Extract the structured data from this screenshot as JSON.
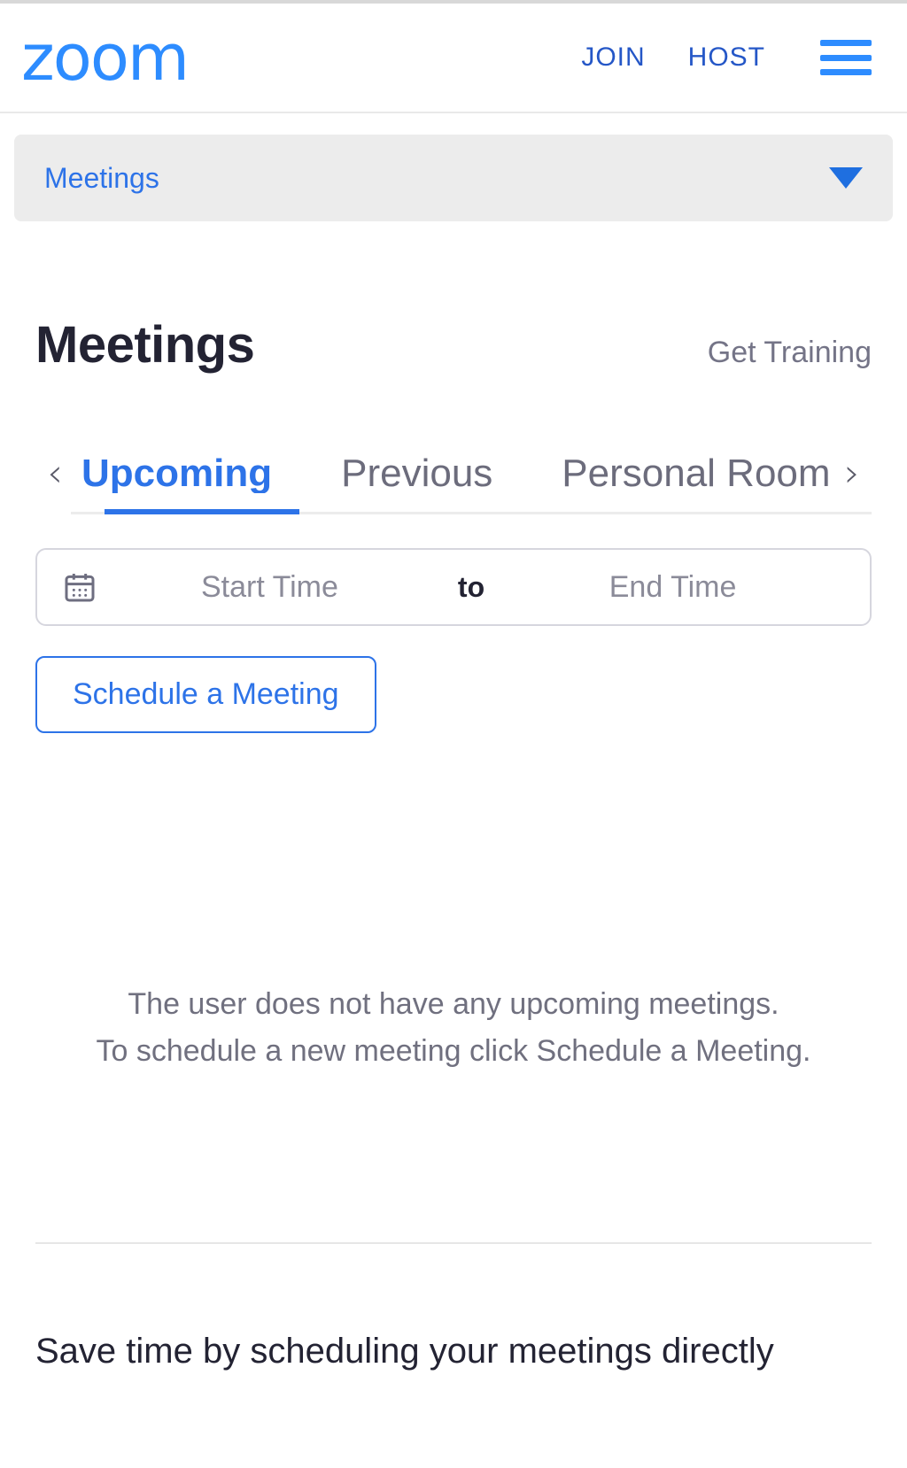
{
  "header": {
    "logo_text": "zoom",
    "links": [
      {
        "label": "JOIN",
        "name": "join-link"
      },
      {
        "label": "HOST",
        "name": "host-link"
      }
    ],
    "menu_icon": "hamburger-menu-icon",
    "logo_color": "#2D8CFF",
    "link_color": "#2557C7"
  },
  "section_select": {
    "label": "Meetings",
    "icon": "chevron-down-icon"
  },
  "main": {
    "title": "Meetings",
    "get_training_label": "Get Training",
    "tabs": {
      "prev_arrow": "‹",
      "next_arrow": "›",
      "items": [
        {
          "label": "Upcoming",
          "active": true
        },
        {
          "label": "Previous",
          "active": false
        },
        {
          "label": "Personal Room",
          "active": false
        }
      ]
    },
    "date_range": {
      "icon": "calendar-icon",
      "start_placeholder": "Start Time",
      "separator": "to",
      "end_placeholder": "End Time",
      "start_value": "",
      "end_value": ""
    },
    "schedule_button_label": "Schedule a Meeting",
    "empty_state": {
      "line1": "The user does not have any upcoming meetings.",
      "line2": "To schedule a new meeting click Schedule a Meeting."
    }
  },
  "promo": {
    "title": "Save time by scheduling your meetings directly"
  },
  "colors": {
    "brand_blue": "#2D8CFF",
    "link_blue": "#2D73E8",
    "text_dark": "#232333",
    "text_muted": "#70707f"
  }
}
